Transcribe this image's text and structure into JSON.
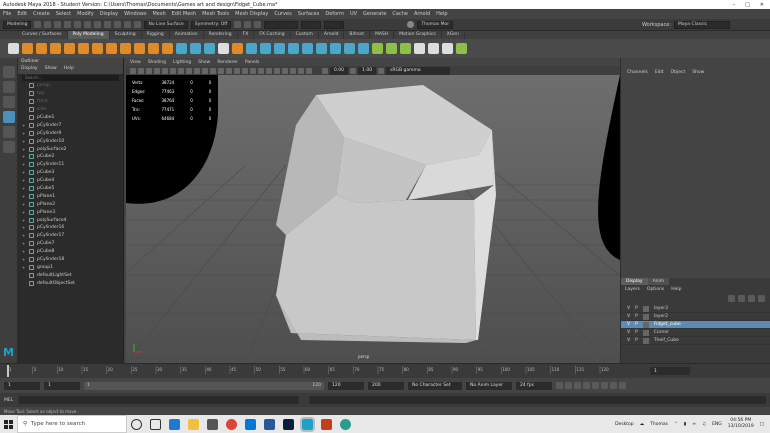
{
  "window": {
    "title": "Autodesk Maya 2018 - Student Version: C:\\Users\\Thomas\\Documents\\Games art and design\\Fidget_Cube.ma*"
  },
  "menubar": [
    "File",
    "Edit",
    "Create",
    "Select",
    "Modify",
    "Display",
    "Windows",
    "Mesh",
    "Edit Mesh",
    "Mesh Tools",
    "Mesh Display",
    "Curves",
    "Surfaces",
    "Deform",
    "UV",
    "Generate",
    "Cache",
    "Arnold",
    "Help"
  ],
  "workspace": {
    "label": "Workspace:",
    "value": "Maya Classic"
  },
  "statusline": {
    "mode": "Modeling",
    "live_surface": "No Live Surface",
    "symmetry": "Symmetry: Off",
    "user": "Thomas Mor"
  },
  "shelf_tabs": [
    "Curves / Surfaces",
    "Poly Modeling",
    "Sculpting",
    "Rigging",
    "Animation",
    "Rendering",
    "FX",
    "FX Caching",
    "Custom",
    "Arnold",
    "Bifrost",
    "MASH",
    "Motion Graphics",
    "XGen"
  ],
  "shelf_active": "Poly Modeling",
  "outliner": {
    "title": "Outliner",
    "menu": [
      "Display",
      "Show",
      "Help"
    ],
    "search_placeholder": "Search...",
    "items": [
      {
        "name": "persp",
        "dim": true,
        "expand": ""
      },
      {
        "name": "top",
        "dim": true,
        "expand": ""
      },
      {
        "name": "front",
        "dim": true,
        "expand": ""
      },
      {
        "name": "side",
        "dim": true,
        "expand": ""
      },
      {
        "name": "pCube1",
        "dim": false,
        "expand": ""
      },
      {
        "name": "pCylinder7",
        "dim": false,
        "expand": "+"
      },
      {
        "name": "pCylinder9",
        "dim": false,
        "expand": "+"
      },
      {
        "name": "pCylinder10",
        "dim": false,
        "expand": "+"
      },
      {
        "name": "polySurface2",
        "dim": false,
        "expand": "+"
      },
      {
        "name": "pCube2",
        "dim": false,
        "expand": "+"
      },
      {
        "name": "pCylinder11",
        "dim": false,
        "expand": "+"
      },
      {
        "name": "pCube3",
        "dim": false,
        "expand": "+"
      },
      {
        "name": "pCube4",
        "dim": false,
        "expand": "+"
      },
      {
        "name": "pCube5",
        "dim": false,
        "expand": "+"
      },
      {
        "name": "pPlane1",
        "dim": false,
        "expand": "+"
      },
      {
        "name": "pPlane2",
        "dim": false,
        "expand": "+"
      },
      {
        "name": "pPlane3",
        "dim": false,
        "expand": "+"
      },
      {
        "name": "polySurface4",
        "dim": false,
        "expand": "+"
      },
      {
        "name": "pCylinder16",
        "dim": false,
        "expand": "+"
      },
      {
        "name": "pCylinder17",
        "dim": false,
        "expand": "+"
      },
      {
        "name": "pCube7",
        "dim": false,
        "expand": "+"
      },
      {
        "name": "pCube8",
        "dim": false,
        "expand": "+"
      },
      {
        "name": "pCylinder18",
        "dim": false,
        "expand": "+"
      },
      {
        "name": "group1",
        "dim": false,
        "expand": "+"
      },
      {
        "name": "defaultLightSet",
        "dim": false,
        "expand": ""
      },
      {
        "name": "defaultObjectSet",
        "dim": false,
        "expand": ""
      }
    ]
  },
  "viewport": {
    "menu": [
      "View",
      "Shading",
      "Lighting",
      "Show",
      "Renderer",
      "Panels"
    ],
    "exposure": "0.00",
    "gamma": "1.00",
    "color_space": "sRGB gamma",
    "camera_label": "persp",
    "hud": [
      {
        "label": "Verts:",
        "v1": "38724",
        "v2": "0",
        "v3": "0"
      },
      {
        "label": "Edges:",
        "v1": "77463",
        "v2": "0",
        "v3": "0"
      },
      {
        "label": "Faces:",
        "v1": "38764",
        "v2": "0",
        "v3": "0"
      },
      {
        "label": "Tris:",
        "v1": "77471",
        "v2": "0",
        "v3": "0"
      },
      {
        "label": "UVs:",
        "v1": "64684",
        "v2": "0",
        "v3": "0"
      }
    ]
  },
  "channel_box": {
    "menu": [
      "Channels",
      "Edit",
      "Object",
      "Show"
    ]
  },
  "layers": {
    "tabs": [
      "Display",
      "Anim"
    ],
    "menu": [
      "Layers",
      "Options",
      "Help"
    ],
    "rows": [
      {
        "v": "V",
        "p": "P",
        "name": "layer3",
        "selected": false
      },
      {
        "v": "V",
        "p": "P",
        "name": "layer2",
        "selected": false
      },
      {
        "v": "V",
        "p": "P",
        "name": "Fidget_cube",
        "selected": true
      },
      {
        "v": "V",
        "p": "P",
        "name": "Corner",
        "selected": false
      },
      {
        "v": "V",
        "p": "P",
        "name": "Theif_Cube",
        "selected": false
      }
    ]
  },
  "timeline": {
    "ticks": [
      "1",
      "5",
      "10",
      "15",
      "20",
      "25",
      "30",
      "35",
      "40",
      "45",
      "50",
      "55",
      "60",
      "65",
      "70",
      "75",
      "80",
      "85",
      "90",
      "95",
      "100",
      "105",
      "110",
      "115",
      "120"
    ],
    "current": "1"
  },
  "range": {
    "start": "1",
    "inner_start": "1",
    "slider_start": "1",
    "slider_end": "120",
    "inner_end": "120",
    "end": "200",
    "char_set": "No Character Set",
    "anim_layer": "No Anim Layer",
    "fps": "24 fps"
  },
  "mel": {
    "label": "MEL"
  },
  "help_line": "Move Tool: Select an object to move.",
  "taskbar": {
    "search_placeholder": "Type here to search",
    "desktop_label": "Desktop",
    "user_label": "Thomas",
    "lang": "ENG",
    "time": "04:56 PM",
    "date": "13/10/2019"
  },
  "colors": {
    "accent": "#5d8bb3",
    "maya_blue": "#1aa2c9",
    "orange": "#e08a2a"
  }
}
